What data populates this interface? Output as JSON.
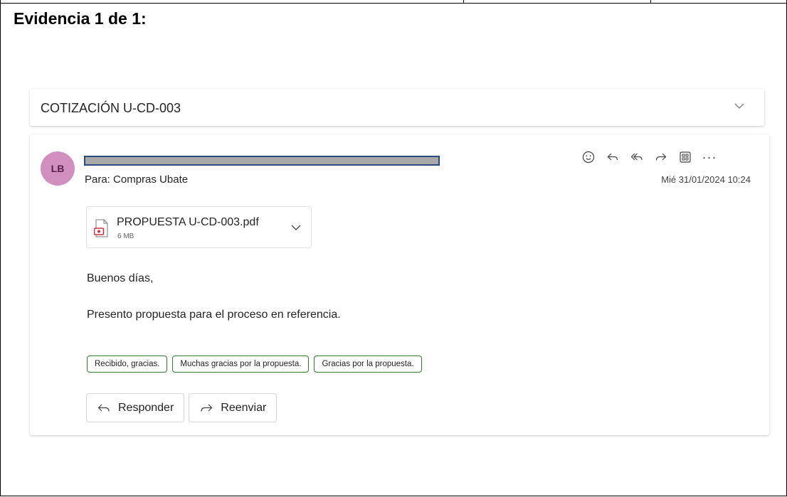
{
  "document": {
    "heading": "Evidencia 1 de 1:"
  },
  "email": {
    "subject": "COTIZACIÓN U-CD-003",
    "sender_initials": "LB",
    "to_label": "Para:",
    "to_value": "Compras Ubate",
    "date": "Mié 31/01/2024 10:24",
    "action_icons": [
      "smiley-icon",
      "reply-icon",
      "reply-all-icon",
      "forward-icon",
      "apps-icon",
      "more-icon"
    ],
    "more_label": "···",
    "attachment": {
      "name": "PROPUESTA U-CD-003.pdf",
      "size": "6 MB"
    },
    "body": {
      "greeting": "Buenos días,",
      "message": "Presento propuesta para el proceso en referencia."
    },
    "suggested_replies": [
      "Recibido, gracias.",
      "Muchas gracias por la propuesta.",
      "Gracias por la propuesta."
    ],
    "reply_label": "Responder",
    "forward_label": "Reenviar"
  },
  "colors": {
    "avatar_bg": "#d18fc0",
    "suggestion_border": "#2e7d32",
    "redaction_fill": "#a8a8a8",
    "redaction_border": "#2b4c7e"
  }
}
